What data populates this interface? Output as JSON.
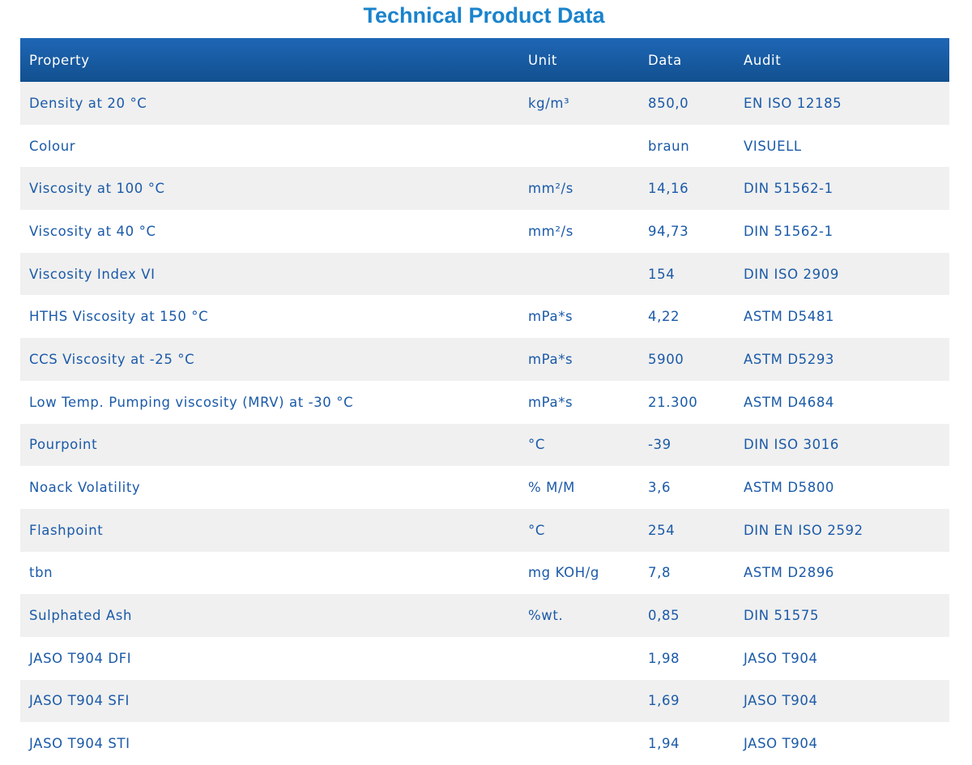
{
  "title": "Technical Product Data",
  "header": {
    "property": "Property",
    "unit": "Unit",
    "data": "Data",
    "audit": "Audit"
  },
  "rows": [
    {
      "property": "Density at 20 °C",
      "unit": "kg/m³",
      "data": "850,0",
      "audit": "EN ISO 12185"
    },
    {
      "property": "Colour",
      "unit": "",
      "data": "braun",
      "audit": "VISUELL"
    },
    {
      "property": "Viscosity at 100 °C",
      "unit": "mm²/s",
      "data": "14,16",
      "audit": "DIN 51562-1"
    },
    {
      "property": "Viscosity at 40 °C",
      "unit": "mm²/s",
      "data": "94,73",
      "audit": "DIN 51562-1"
    },
    {
      "property": "Viscosity Index VI",
      "unit": "",
      "data": "154",
      "audit": "DIN ISO 2909"
    },
    {
      "property": "HTHS Viscosity at 150 °C",
      "unit": "mPa*s",
      "data": "4,22",
      "audit": "ASTM D5481"
    },
    {
      "property": "CCS Viscosity at -25 °C",
      "unit": "mPa*s",
      "data": "5900",
      "audit": "ASTM D5293"
    },
    {
      "property": "Low Temp. Pumping viscosity (MRV) at -30 °C",
      "unit": "mPa*s",
      "data": "21.300",
      "audit": "ASTM D4684"
    },
    {
      "property": "Pourpoint",
      "unit": "°C",
      "data": "-39",
      "audit": "DIN ISO 3016"
    },
    {
      "property": "Noack Volatility",
      "unit": "% M/M",
      "data": "3,6",
      "audit": "ASTM D5800"
    },
    {
      "property": "Flashpoint",
      "unit": "°C",
      "data": "254",
      "audit": "DIN EN ISO 2592"
    },
    {
      "property": "tbn",
      "unit": "mg KOH/g",
      "data": "7,8",
      "audit": "ASTM D2896"
    },
    {
      "property": "Sulphated Ash",
      "unit": "%wt.",
      "data": "0,85",
      "audit": "DIN 51575"
    },
    {
      "property": "JASO T904 DFI",
      "unit": "",
      "data": "1,98",
      "audit": "JASO T904"
    },
    {
      "property": "JASO T904 SFI",
      "unit": "",
      "data": "1,69",
      "audit": "JASO T904"
    },
    {
      "property": "JASO T904 STI",
      "unit": "",
      "data": "1,94",
      "audit": "JASO T904"
    }
  ]
}
